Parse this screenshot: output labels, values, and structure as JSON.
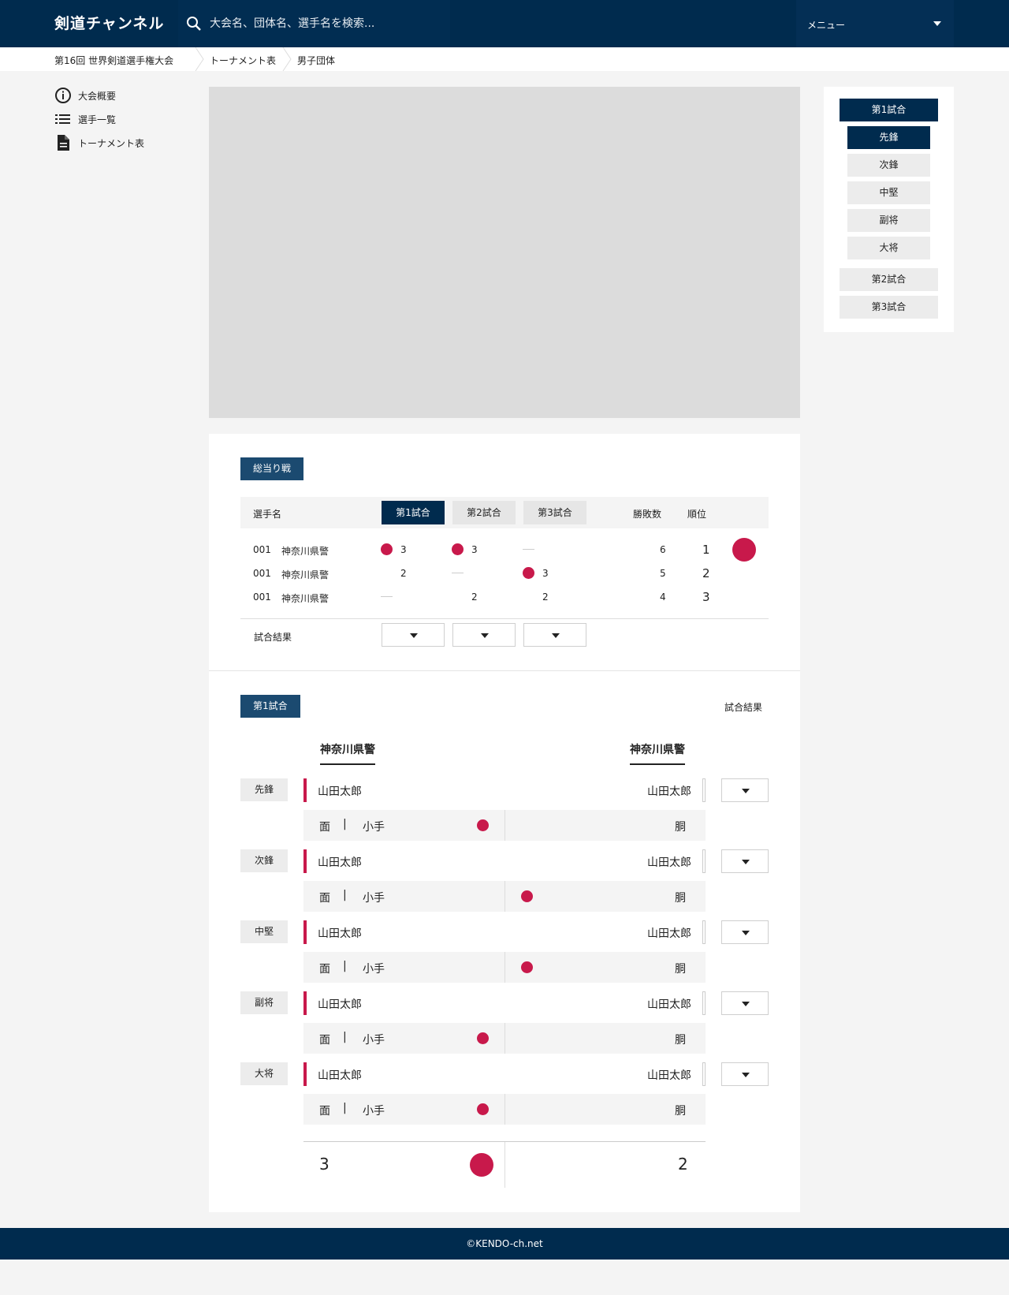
{
  "header": {
    "logo": "剣道チャンネル",
    "search_placeholder": "大会名、団体名、選手名を検索...",
    "menu_label": "メニュー"
  },
  "breadcrumb": [
    "第16回 世界剣道選手権大会",
    "トーナメント表",
    "男子団体"
  ],
  "sidebar": [
    {
      "label": "大会概要",
      "icon": "info-icon"
    },
    {
      "label": "選手一覧",
      "icon": "list-icon"
    },
    {
      "label": "トーナメント表",
      "icon": "document-icon"
    }
  ],
  "round_robin": {
    "tag": "総当り戦",
    "headers": {
      "player": "選手名",
      "matches": [
        "第1試合",
        "第2試合",
        "第3試合"
      ],
      "wins": "勝敗数",
      "rank": "順位"
    },
    "rows": [
      {
        "no": "001",
        "team": "神奈川県警",
        "m1": "3",
        "m2": "3",
        "m3": "",
        "wins": "6",
        "rank": "1"
      },
      {
        "no": "001",
        "team": "神奈川県警",
        "m1": "2",
        "m2": "",
        "m3": "3",
        "wins": "5",
        "rank": "2"
      },
      {
        "no": "001",
        "team": "神奈川県警",
        "m1": "",
        "m2": "2",
        "m3": "2",
        "wins": "4",
        "rank": "3"
      }
    ],
    "result_label": "試合結果"
  },
  "match": {
    "tag": "第1試合",
    "result_label": "試合結果",
    "team_left": "神奈川県警",
    "team_right": "神奈川県警",
    "bouts": [
      {
        "pos": "先鋒",
        "left": "山田太郎",
        "right": "山田太郎",
        "w1": "面",
        "sep": "|",
        "w2": "小手",
        "wr": "胴",
        "winner": "left"
      },
      {
        "pos": "次鋒",
        "left": "山田太郎",
        "right": "山田太郎",
        "w1": "面",
        "sep": "|",
        "w2": "小手",
        "wr": "胴",
        "winner": "right"
      },
      {
        "pos": "中堅",
        "left": "山田太郎",
        "right": "山田太郎",
        "w1": "面",
        "sep": "|",
        "w2": "小手",
        "wr": "胴",
        "winner": "right"
      },
      {
        "pos": "副将",
        "left": "山田太郎",
        "right": "山田太郎",
        "w1": "面",
        "sep": "|",
        "w2": "小手",
        "wr": "胴",
        "winner": "left"
      },
      {
        "pos": "大将",
        "left": "山田太郎",
        "right": "山田太郎",
        "w1": "面",
        "sep": "|",
        "w2": "小手",
        "wr": "胴",
        "winner": "left"
      }
    ],
    "score_left": "3",
    "score_right": "2"
  },
  "right_nav": {
    "matches": [
      "第1試合",
      "第2試合",
      "第3試合"
    ],
    "positions": [
      "先鋒",
      "次鋒",
      "中堅",
      "副将",
      "大将"
    ]
  },
  "footer": "©KENDO-ch.net",
  "colors": {
    "navy": "#002b4e",
    "accent": "#c8194b",
    "tag": "#1b4a70"
  }
}
